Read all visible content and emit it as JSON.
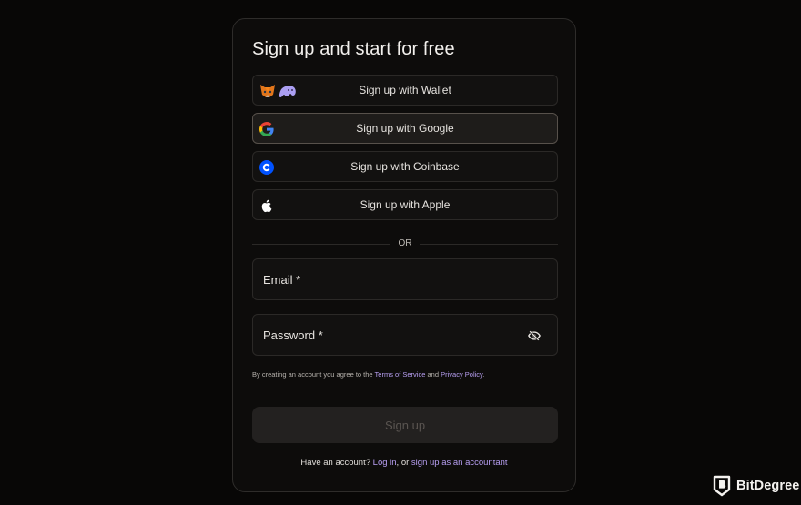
{
  "form": {
    "title": "Sign up and start for free",
    "sso": [
      {
        "label": "Sign up with Wallet",
        "icons": [
          "fox-icon",
          "ghost-icon"
        ]
      },
      {
        "label": "Sign up with Google",
        "icons": [
          "google-icon"
        ]
      },
      {
        "label": "Sign up with Coinbase",
        "icons": [
          "coinbase-icon"
        ]
      },
      {
        "label": "Sign up with Apple",
        "icons": [
          "apple-icon"
        ]
      }
    ],
    "divider": "OR",
    "email_label": "Email *",
    "password_label": "Password *",
    "legal": {
      "prefix": "By creating an account you agree to the",
      "terms": "Terms of Service",
      "and": "and",
      "privacy": "Privacy Policy",
      "suffix": "."
    },
    "submit": "Sign up",
    "footer": {
      "prefix": "Have an account?",
      "login": "Log in",
      "middle": ", or",
      "accountant": "sign up as an accountant"
    }
  },
  "brand": {
    "name": "BitDegree"
  },
  "colors": {
    "background": "#080706",
    "card": "#0d0c0b",
    "link": "#b79ff2",
    "submit_disabled": "#232120"
  }
}
